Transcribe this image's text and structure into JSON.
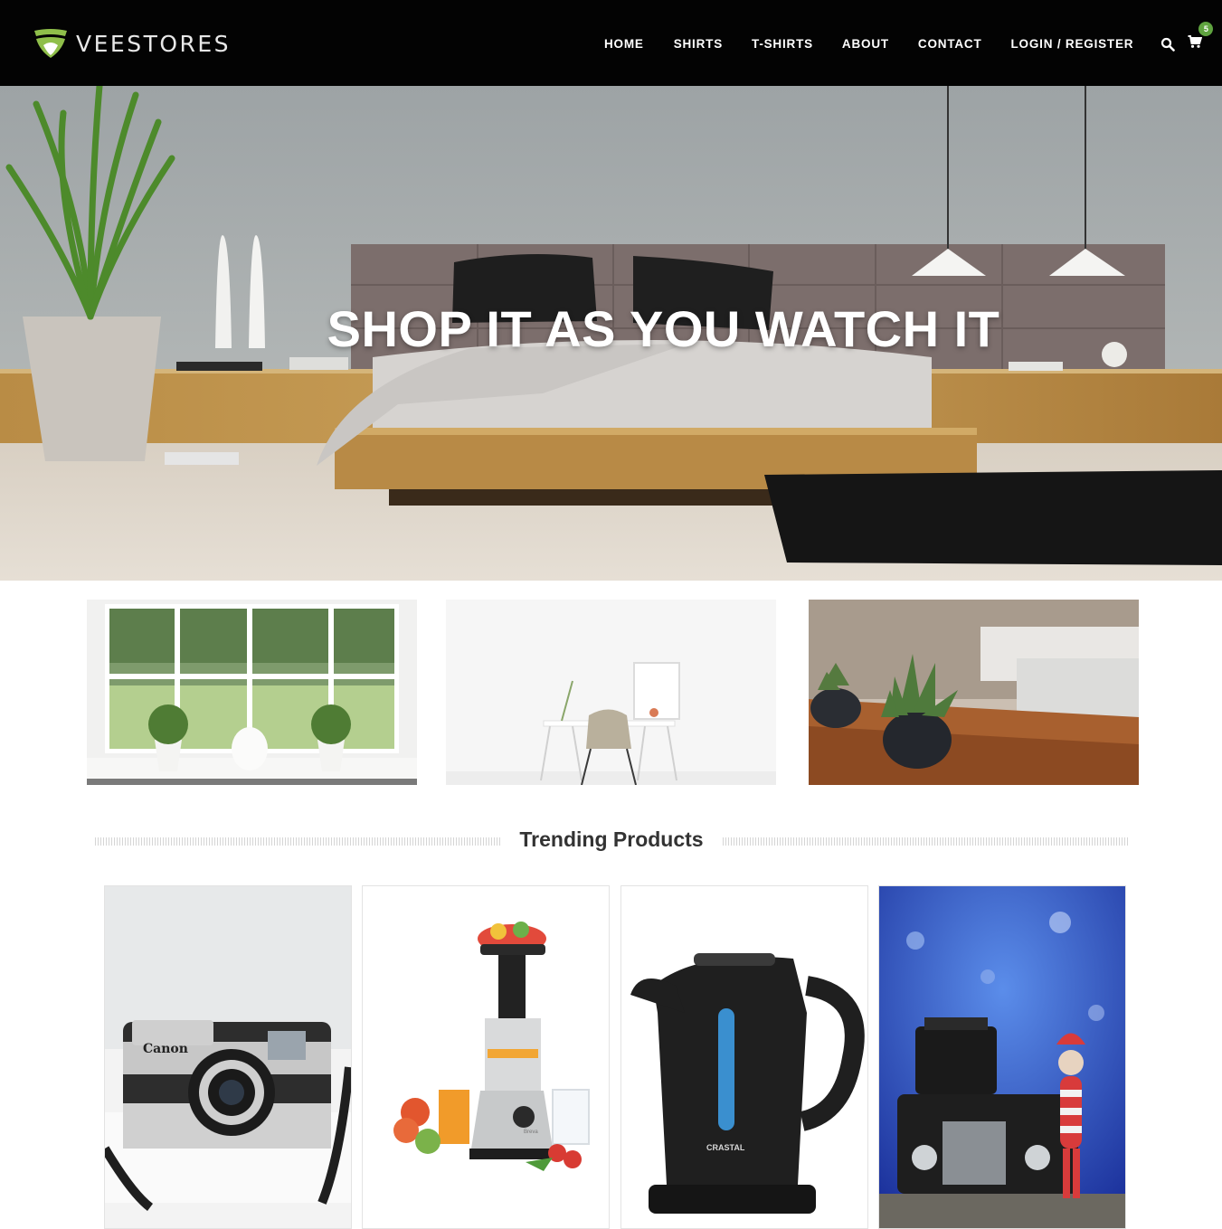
{
  "header": {
    "brand": "VEESTORES",
    "nav": {
      "home": "HOME",
      "shirts": "SHIRTS",
      "tshirts": "T-SHIRTS",
      "about": "ABOUT",
      "contact": "CONTACT",
      "login": "LOGIN / REGISTER"
    },
    "cart_count": "5",
    "icons": {
      "search": "search-icon",
      "cart": "cart-icon"
    }
  },
  "hero": {
    "title": "SHOP IT AS YOU WATCH IT",
    "image": "bedroom-interior"
  },
  "categories": [
    {
      "image": "window-plants"
    },
    {
      "image": "white-desk-chair"
    },
    {
      "image": "potted-succulents-table"
    }
  ],
  "trending": {
    "title": "Trending Products",
    "products": [
      {
        "image": "canon-camera",
        "brand_mark": "Canon"
      },
      {
        "image": "juicer-fruits",
        "brand_mark": "Breva"
      },
      {
        "image": "electric-kettle",
        "brand_mark": "CRASTAL"
      },
      {
        "image": "camera-toy-figure"
      }
    ]
  },
  "colors": {
    "header_bg": "#030303",
    "accent": "#5fa33f",
    "nav_text": "#ffffff"
  }
}
